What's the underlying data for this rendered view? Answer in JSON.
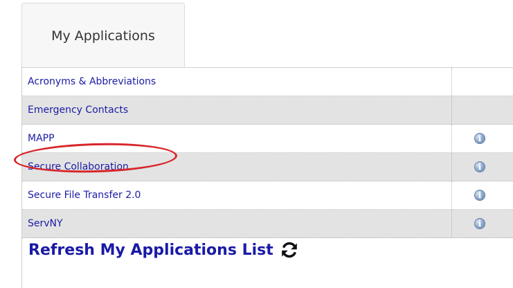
{
  "tab": {
    "label": "My Applications"
  },
  "applications": [
    {
      "name": "Acronyms & Abbreviations",
      "has_info": false
    },
    {
      "name": "Emergency Contacts",
      "has_info": false
    },
    {
      "name": "MAPP",
      "has_info": true
    },
    {
      "name": "Secure Collaboration",
      "has_info": true,
      "highlighted": true
    },
    {
      "name": "Secure File Transfer 2.0",
      "has_info": true
    },
    {
      "name": "ServNY",
      "has_info": true
    }
  ],
  "info_icon": {
    "name": "info-icon",
    "glyph": "i"
  },
  "refresh": {
    "label": "Refresh My Applications List",
    "icon": "refresh-icon"
  },
  "colors": {
    "link": "#1a1aa6",
    "row_alt": "#e3e3e3",
    "highlight": "#d8262b"
  }
}
